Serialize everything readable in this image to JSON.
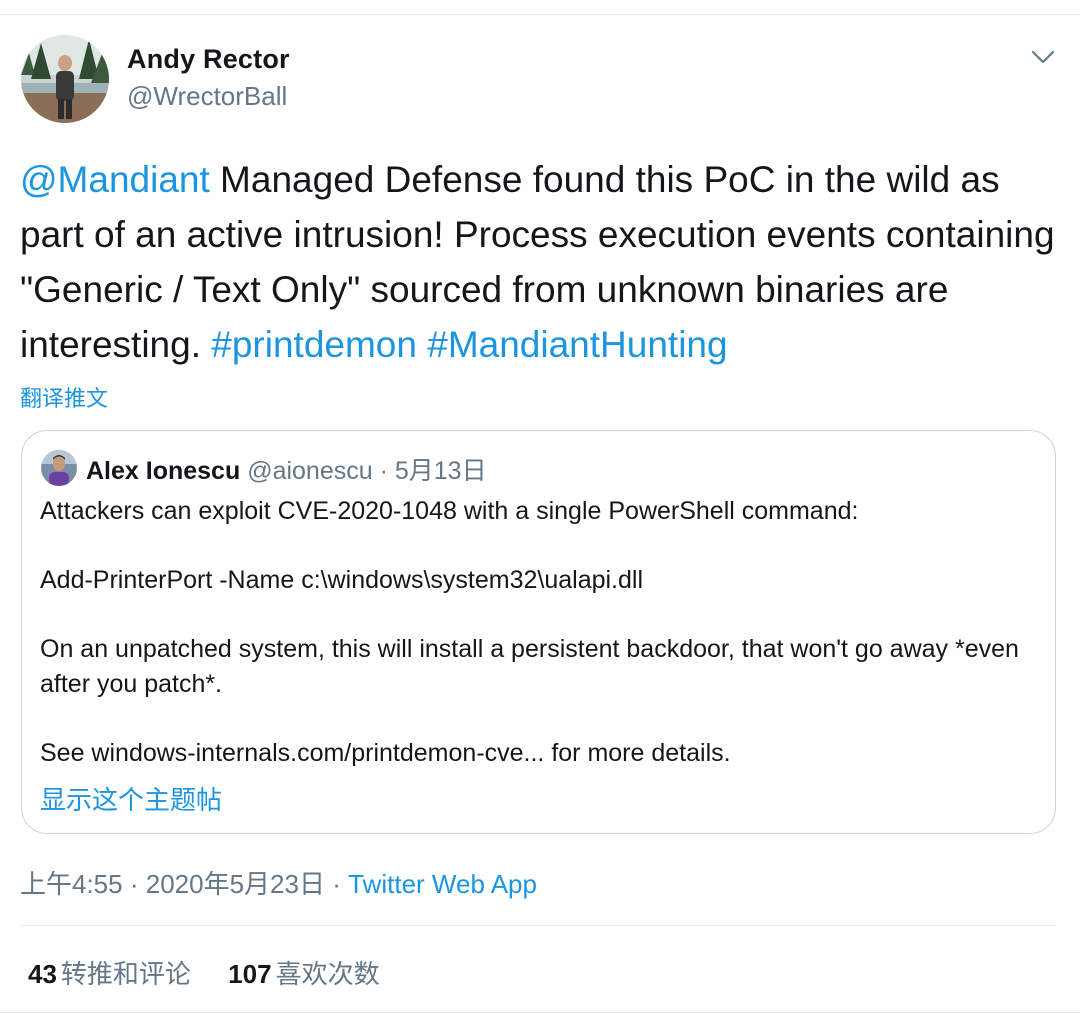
{
  "tweet": {
    "author": {
      "name": "Andy Rector",
      "handle": "@WrectorBall"
    },
    "text_segments": [
      {
        "text": "@Mandiant",
        "link": true
      },
      {
        "text": " Managed Defense found this PoC in the wild as part of an active intrusion! Process execution events containing \"Generic / Text Only\" sourced from unknown binaries are interesting. ",
        "link": false
      },
      {
        "text": "#printdemon",
        "link": true
      },
      {
        "text": " ",
        "link": false
      },
      {
        "text": "#MandiantHunting",
        "link": true
      }
    ],
    "translate_label": "翻译推文",
    "menu_icon": "chevron-down-icon"
  },
  "quoted": {
    "name": "Alex Ionescu",
    "handle": "@aionescu",
    "separator": "·",
    "date": "5月13日",
    "paragraphs": [
      "Attackers can exploit CVE-2020-1048 with a single PowerShell command:",
      "Add-PrinterPort -Name c:\\windows\\system32\\ualapi.dll",
      "On an unpatched system, this will install a persistent backdoor, that won't go away *even after you patch*.",
      "See windows-internals.com/printdemon-cve... for more details."
    ],
    "show_thread_label": "显示这个主题帖"
  },
  "meta": {
    "time": "上午4:55",
    "separator1": "·",
    "date": "2020年5月23日",
    "separator2": "·",
    "source": "Twitter Web App"
  },
  "stats": {
    "retweets_count": "43",
    "retweets_label": "转推和评论",
    "likes_count": "107",
    "likes_label": "喜欢次数"
  },
  "colors": {
    "link": "#1b95e0",
    "secondary_text": "#657786",
    "primary_text": "#14171a",
    "border": "#ccd6dd"
  }
}
